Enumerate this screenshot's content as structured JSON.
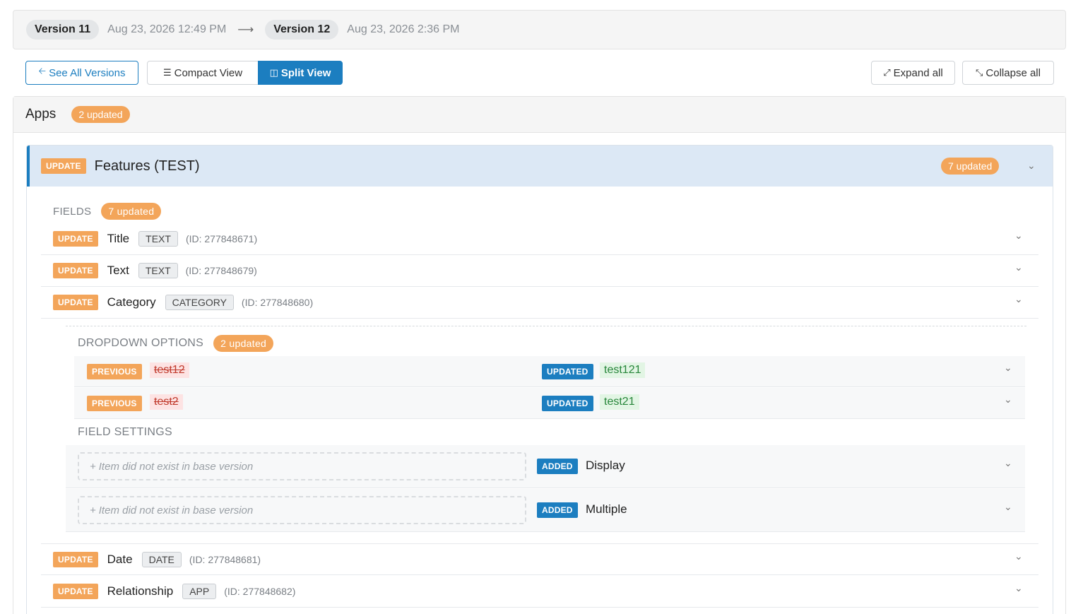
{
  "version_bar": {
    "base_version": "Version 11",
    "base_date": "Aug 23, 2026 12:49 PM",
    "target_version": "Version 12",
    "target_date": "Aug 23, 2026 2:36 PM"
  },
  "toolbar": {
    "see_all": "See All Versions",
    "compact_view": "Compact View",
    "split_view": "Split View",
    "expand_all": "Expand all",
    "collapse_all": "Collapse all"
  },
  "apps": {
    "title": "Apps",
    "count": "2 updated"
  },
  "feature": {
    "tag": "UPDATE",
    "title": "Features (TEST)",
    "count": "7 updated",
    "fields_label": "FIELDS",
    "fields_count": "7 updated",
    "fields": [
      {
        "tag": "UPDATE",
        "name": "Title",
        "type": "TEXT",
        "id": "(ID: 277848671)"
      },
      {
        "tag": "UPDATE",
        "name": "Text",
        "type": "TEXT",
        "id": "(ID: 277848679)"
      },
      {
        "tag": "UPDATE",
        "name": "Category",
        "type": "CATEGORY",
        "id": "(ID: 277848680)"
      },
      {
        "tag": "UPDATE",
        "name": "Date",
        "type": "DATE",
        "id": "(ID: 277848681)"
      },
      {
        "tag": "UPDATE",
        "name": "Relationship",
        "type": "APP",
        "id": "(ID: 277848682)"
      }
    ],
    "dropdown": {
      "label": "DROPDOWN OPTIONS",
      "count": "2 updated",
      "options": [
        {
          "prev_tag": "PREVIOUS",
          "old": "test12",
          "upd_tag": "UPDATED",
          "new": "test121"
        },
        {
          "prev_tag": "PREVIOUS",
          "old": "test2",
          "upd_tag": "UPDATED",
          "new": "test21"
        }
      ]
    },
    "settings": {
      "label": "FIELD SETTINGS",
      "items": [
        {
          "placeholder": "Item did not exist in base version",
          "tag": "ADDED",
          "name": "Display"
        },
        {
          "placeholder": "Item did not exist in base version",
          "tag": "ADDED",
          "name": "Multiple"
        }
      ]
    }
  },
  "icons": {
    "arrow": "arrow-right-icon",
    "back": "arrow-left-icon",
    "list": "list-icon",
    "split": "columns-icon",
    "expand": "expand-icon",
    "collapse": "collapse-icon",
    "chevron": "chevron-down-icon",
    "plus": "plus-icon"
  },
  "colors": {
    "accent": "#1c7ec0",
    "update": "#f3a55a",
    "removed_bg": "#fde3e3",
    "added_bg": "#e2f5e4"
  }
}
